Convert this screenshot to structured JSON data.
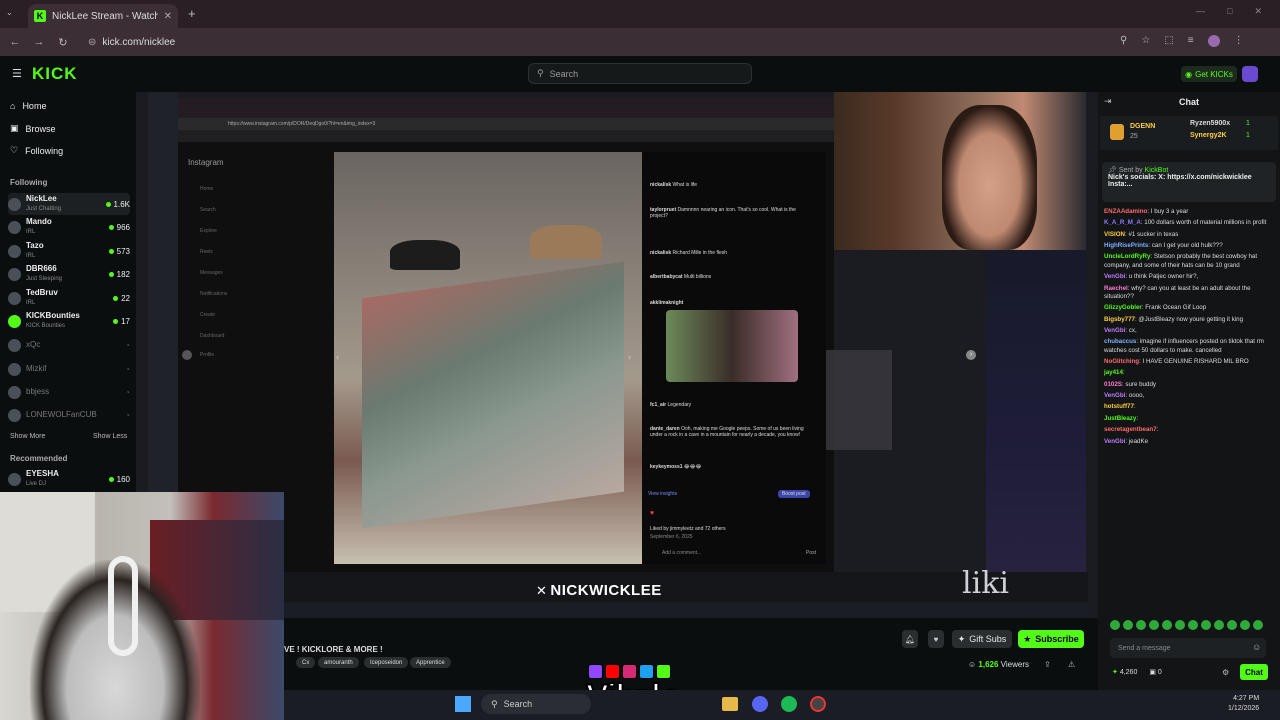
{
  "browser": {
    "tab_title": "NickLee Stream - Watch Li...",
    "url": "kick.com/nicklee",
    "new_tab": "+",
    "back": "←",
    "forward": "→",
    "reload": "↻"
  },
  "header": {
    "logo": "KICK",
    "search_placeholder": "Search",
    "get_kicks": "Get KICKs"
  },
  "sidebar": {
    "nav": [
      {
        "label": "Home",
        "icon": "home-icon"
      },
      {
        "label": "Browse",
        "icon": "browse-icon"
      },
      {
        "label": "Following",
        "icon": "heart-icon"
      }
    ],
    "following_title": "Following",
    "channels": [
      {
        "name": "NickLee",
        "sub": "Just Chatting",
        "viewers": "1.6K",
        "live": true
      },
      {
        "name": "Mando",
        "sub": "IRL",
        "viewers": "966",
        "live": true
      },
      {
        "name": "Tazo",
        "sub": "IRL",
        "viewers": "573",
        "live": true
      },
      {
        "name": "DBR666",
        "sub": "Just Sleeping",
        "viewers": "182",
        "live": true
      },
      {
        "name": "TedBruv",
        "sub": "IRL",
        "viewers": "22",
        "live": true
      },
      {
        "name": "KICKBounties",
        "sub": "KICK Bounties",
        "viewers": "17",
        "live": true
      },
      {
        "name": "xQc",
        "sub": "",
        "viewers": "",
        "live": false
      },
      {
        "name": "Mizkif",
        "sub": "",
        "viewers": "",
        "live": false
      },
      {
        "name": "bbjess",
        "sub": "",
        "viewers": "",
        "live": false
      },
      {
        "name": "LONEWOLFanCUB",
        "sub": "",
        "viewers": "",
        "live": false
      }
    ],
    "show_more": "Show More",
    "show_less": "Show Less",
    "recommended_title": "Recommended",
    "recommended": [
      {
        "name": "EYESHA",
        "sub": "Live DJ",
        "viewers": "160"
      }
    ]
  },
  "stream": {
    "ig_url": "https://www.instagram.com/p/DOR/DeqDgo0/?hl=en&img_index=3",
    "ig_brand": "Instagram",
    "ig_menu": [
      "Home",
      "Search",
      "Explore",
      "Reels",
      "Messages",
      "Notifications",
      "Create",
      "Dashboard",
      "Profile"
    ],
    "ig_comments": [
      {
        "user": "nickalisk",
        "text": "What is life"
      },
      {
        "user": "taylorpruet",
        "text": "Damnnnn nearing an icon. That's so cool. What is the project?"
      },
      {
        "user": "nickalisk",
        "text": "Richard Mille in the flesh"
      },
      {
        "user": "albertbabycat",
        "text": "Multi billions"
      },
      {
        "user": "akklimaknight",
        "text": ""
      },
      {
        "user": "fc1_air",
        "text": "Legendary"
      },
      {
        "user": "dante_daren",
        "text": "Ooh, making me Google peeps. Some of us been living under a rock in a cave in a mountain for nearly a decade, you know!"
      },
      {
        "user": "keykeymoss1",
        "text": "😂😂😂"
      }
    ],
    "ig_view_insights": "View insights",
    "ig_boost": "Boost post",
    "ig_liked": "Liked by jimmyleetz and 72 others",
    "ig_date": "September 6, 2025",
    "ig_add_comment": "Add a comment...",
    "ig_post": "Post",
    "overlay_name": "NICKWICKLEE",
    "overlay_right": "liki",
    "title": "VE ! KICKLORE & MORE !",
    "tags": [
      "Cx",
      "amouranth",
      "Iceposeidon",
      "Apprentice"
    ],
    "viewers": "1,626",
    "viewers_label": "Viewers",
    "gift_subs": "Gift Subs",
    "subscribe": "Subscribe"
  },
  "watermark": {
    "text": "Vibzlo"
  },
  "taskbar": {
    "search": "Search",
    "time": "4:27 PM",
    "date": "1/12/2026"
  },
  "chat": {
    "title": "Chat",
    "top_gifter": "DGENN",
    "top_gifter_count": "25",
    "gifters": [
      {
        "name": "Ryzen5900x",
        "count": "1"
      },
      {
        "name": "Synergy2K",
        "count": "1"
      }
    ],
    "pinned_by": "Sent by",
    "pinned_author": "KickBot",
    "pinned_text": "Nick's socials: X: https://x.com/nickwicklee Insta:...",
    "messages": [
      {
        "user": "ENZAAdamino",
        "color": "#ff6b6b",
        "text": "I buy 3 a year"
      },
      {
        "user": "K_A_R_M_A",
        "color": "#8f7bff",
        "text": "100 dollars worth of material millions in profit"
      },
      {
        "user": "VISION",
        "color": "#ffcf40",
        "text": "#1 sucker in texas"
      },
      {
        "user": "HighRisePrints",
        "color": "#7fb2ff",
        "text": "can I get your old hulk???"
      },
      {
        "user": "UncleLordRyRy",
        "color": "#53fc18",
        "text": "Stetson probably the best cowboy hat company, and some of their hats can be 10 grand"
      },
      {
        "user": "VenGbi",
        "color": "#c07bff",
        "text": "u think Patjec owner hir?,"
      },
      {
        "user": "Raechel",
        "color": "#ff7bd4",
        "text": "why? can you at least be an adult about the situation??"
      },
      {
        "user": "GlizzyGobler",
        "color": "#53fc18",
        "text": "Frank Ocean Gif Loop"
      },
      {
        "user": "Bigsby777",
        "color": "#ffcf40",
        "text": "@JustBleazy now youre getting it king"
      },
      {
        "user": "VenGbi",
        "color": "#c07bff",
        "text": "cx,"
      },
      {
        "user": "chubaccus",
        "color": "#7fb2ff",
        "text": "imagine if influencers posted on tiktok that rm watches cost 50 dollars to make. cancelled"
      },
      {
        "user": "NoGlitching",
        "color": "#ff6b6b",
        "text": "I HAVE GENUINE RISHARD MIL BRO"
      },
      {
        "user": "jay414",
        "color": "#53fc18",
        "text": ""
      },
      {
        "user": "0102S",
        "color": "#ff7bd4",
        "text": "sure buddy"
      },
      {
        "user": "VenGbi",
        "color": "#c07bff",
        "text": "oooo,"
      },
      {
        "user": "hotstuff77",
        "color": "#ffcf40",
        "text": ""
      },
      {
        "user": "JustBleazy",
        "color": "#53fc18",
        "text": ""
      },
      {
        "user": "secretagentbean7",
        "color": "#ff6b6b",
        "text": ""
      },
      {
        "user": "VenGbi",
        "color": "#c07bff",
        "text": "jeadKe"
      }
    ],
    "input_placeholder": "Send a message",
    "points": "4,260",
    "points_two": "0",
    "send": "Chat"
  }
}
